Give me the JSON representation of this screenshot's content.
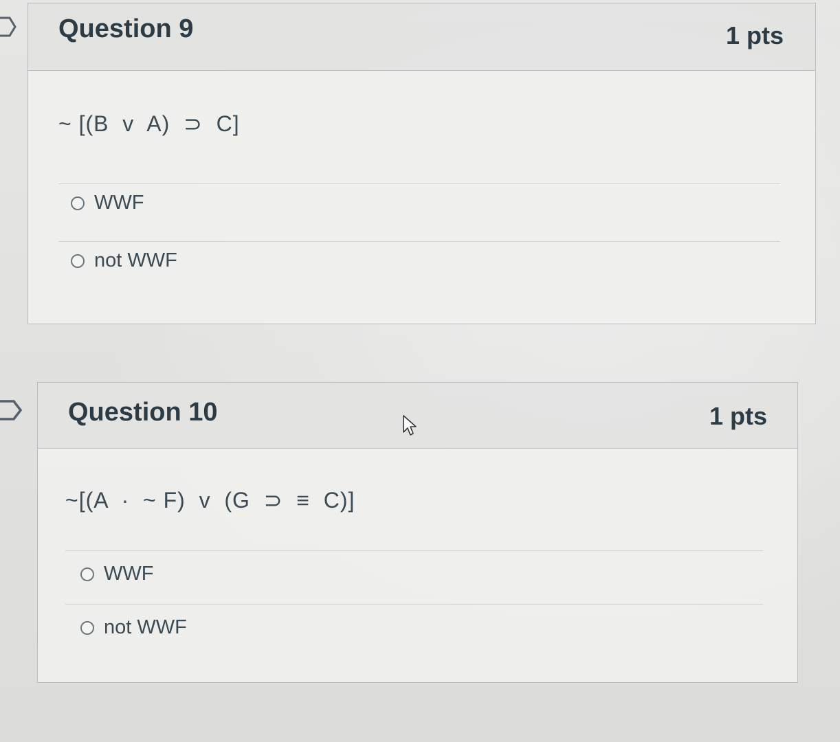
{
  "questions": [
    {
      "title": "Question 9",
      "points": "1 pts",
      "text": "~ [(B  v  A)  ⊃  C]",
      "answers": [
        "WWF",
        "not WWF"
      ]
    },
    {
      "title": "Question 10",
      "points": "1 pts",
      "text": "~[(A  ·  ~ F)  v  (G  ⊃  ≡  C)]",
      "answers": [
        "WWF",
        "not WWF"
      ]
    }
  ]
}
